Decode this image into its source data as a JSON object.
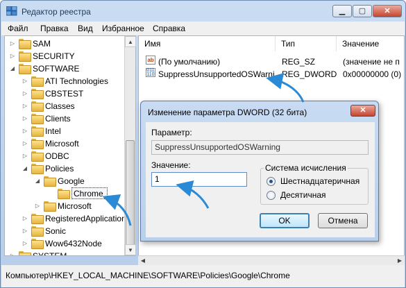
{
  "window": {
    "title": "Редактор реестра"
  },
  "menu": [
    "Файл",
    "Правка",
    "Вид",
    "Избранное",
    "Справка"
  ],
  "tree": {
    "items": [
      {
        "label": "SAM",
        "expander": "▷"
      },
      {
        "label": "SECURITY",
        "expander": "▷"
      },
      {
        "label": "SOFTWARE",
        "expander": "◢"
      },
      {
        "label": "ATI Technologies",
        "expander": "▷"
      },
      {
        "label": "CBSTEST",
        "expander": "▷"
      },
      {
        "label": "Classes",
        "expander": "▷"
      },
      {
        "label": "Clients",
        "expander": "▷"
      },
      {
        "label": "Intel",
        "expander": "▷"
      },
      {
        "label": "Microsoft",
        "expander": "▷"
      },
      {
        "label": "ODBC",
        "expander": "▷"
      },
      {
        "label": "Policies",
        "expander": "◢"
      },
      {
        "label": "Google",
        "expander": "◢"
      },
      {
        "label": "Chrome",
        "expander": ""
      },
      {
        "label": "Microsoft",
        "expander": "▷"
      },
      {
        "label": "RegisteredApplication",
        "expander": "▷"
      },
      {
        "label": "Sonic",
        "expander": "▷"
      },
      {
        "label": "Wow6432Node",
        "expander": "▷"
      },
      {
        "label": "SYSTEM",
        "expander": "▷"
      }
    ]
  },
  "list": {
    "columns": [
      "Имя",
      "Тип",
      "Значение"
    ],
    "rows": [
      {
        "name": "(По умолчанию)",
        "type": "REG_SZ",
        "value": "(значение не п",
        "icon": "string-value-icon"
      },
      {
        "name": "SuppressUnsupportedOSWarni...",
        "type": "REG_DWORD",
        "value": "0x00000000 (0)",
        "icon": "binary-value-icon"
      }
    ]
  },
  "status": "Компьютер\\HKEY_LOCAL_MACHINE\\SOFTWARE\\Policies\\Google\\Chrome",
  "dialog": {
    "title": "Изменение параметра DWORD (32 бита)",
    "param_label": "Параметр:",
    "param_value": "SuppressUnsupportedOSWarning",
    "value_label": "Значение:",
    "value": "1",
    "base_group": "Система исчисления",
    "base_options": [
      "Шестнадцатеричная",
      "Десятичная"
    ],
    "base_selected": "Шестнадцатеричная",
    "ok": "OK",
    "cancel": "Отмена"
  },
  "colors": {
    "annotation_arrow": "#2b8ad6"
  }
}
